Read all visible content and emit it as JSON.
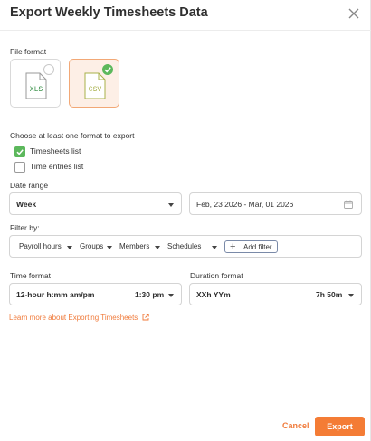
{
  "dialog": {
    "title": "Export Weekly Timesheets Data"
  },
  "file_format": {
    "label": "File format",
    "options": [
      {
        "name": "XLS",
        "selected": false
      },
      {
        "name": "CSV",
        "selected": true
      }
    ]
  },
  "export_choice": {
    "label": "Choose at least one format to export",
    "items": [
      {
        "label": "Timesheets list",
        "checked": true
      },
      {
        "label": "Time entries list",
        "checked": false
      }
    ]
  },
  "date_range": {
    "label": "Date range",
    "period": "Week",
    "range": "Feb, 23 2026 - Mar, 01 2026"
  },
  "filter": {
    "label": "Filter by:",
    "items": [
      "Payroll hours",
      "Groups",
      "Members",
      "Schedules"
    ],
    "add_label": "Add filter"
  },
  "time_format": {
    "label": "Time format",
    "value": "12-hour h:mm am/pm",
    "example": "1:30 pm"
  },
  "duration_format": {
    "label": "Duration format",
    "value": "XXh YYm",
    "example": "7h 50m"
  },
  "learn_more": "Learn more about Exporting Timesheets",
  "footer": {
    "cancel": "Cancel",
    "export": "Export"
  },
  "colors": {
    "accent": "#f47c35",
    "success": "#5cb85c",
    "selected_card_bg": "#fdefe6"
  },
  "icons": {
    "close": "close-icon",
    "calendar": "calendar-icon",
    "external_link": "external-link-icon",
    "dropdown": "chevron-down-icon"
  }
}
